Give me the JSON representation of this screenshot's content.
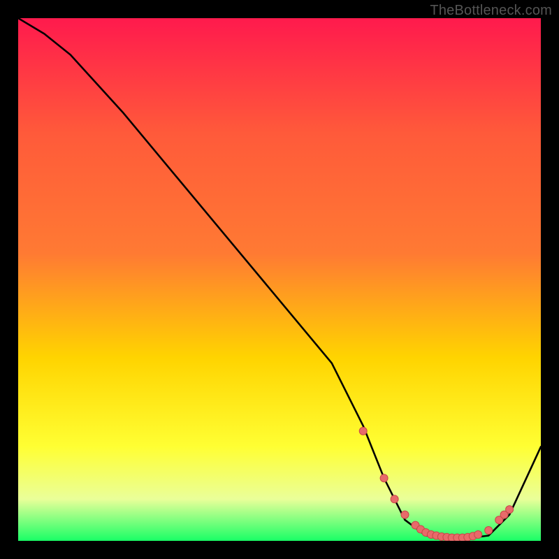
{
  "watermark": "TheBottleneck.com",
  "colors": {
    "bg": "#000000",
    "gradient_top": "#ff1a4d",
    "gradient_mid1": "#ff7a33",
    "gradient_mid2": "#ffd400",
    "gradient_mid3": "#ffff33",
    "gradient_mid4": "#eaff99",
    "gradient_bottom": "#19ff66",
    "curve": "#000000",
    "marker_fill": "#e86a6a",
    "marker_stroke": "#c84848"
  },
  "chart_data": {
    "type": "line",
    "title": "",
    "xlabel": "",
    "ylabel": "",
    "xlim": [
      0,
      100
    ],
    "ylim": [
      0,
      100
    ],
    "series": [
      {
        "name": "main-curve",
        "x": [
          0,
          5,
          10,
          20,
          30,
          40,
          50,
          60,
          66,
          70,
          74,
          78,
          82,
          86,
          90,
          94,
          100
        ],
        "y": [
          100,
          97,
          93,
          82,
          70,
          58,
          46,
          34,
          22,
          12,
          4,
          1,
          0.5,
          0.5,
          1,
          5,
          18
        ]
      }
    ],
    "markers": {
      "name": "highlight-points",
      "x": [
        66,
        70,
        72,
        74,
        76,
        77,
        78,
        79,
        80,
        81,
        82,
        83,
        84,
        85,
        86,
        87,
        88,
        90,
        92,
        93,
        94
      ],
      "y": [
        21,
        12,
        8,
        5,
        3,
        2.2,
        1.6,
        1.2,
        1,
        0.8,
        0.7,
        0.6,
        0.6,
        0.6,
        0.7,
        0.9,
        1.2,
        2,
        4,
        5,
        6
      ]
    }
  }
}
